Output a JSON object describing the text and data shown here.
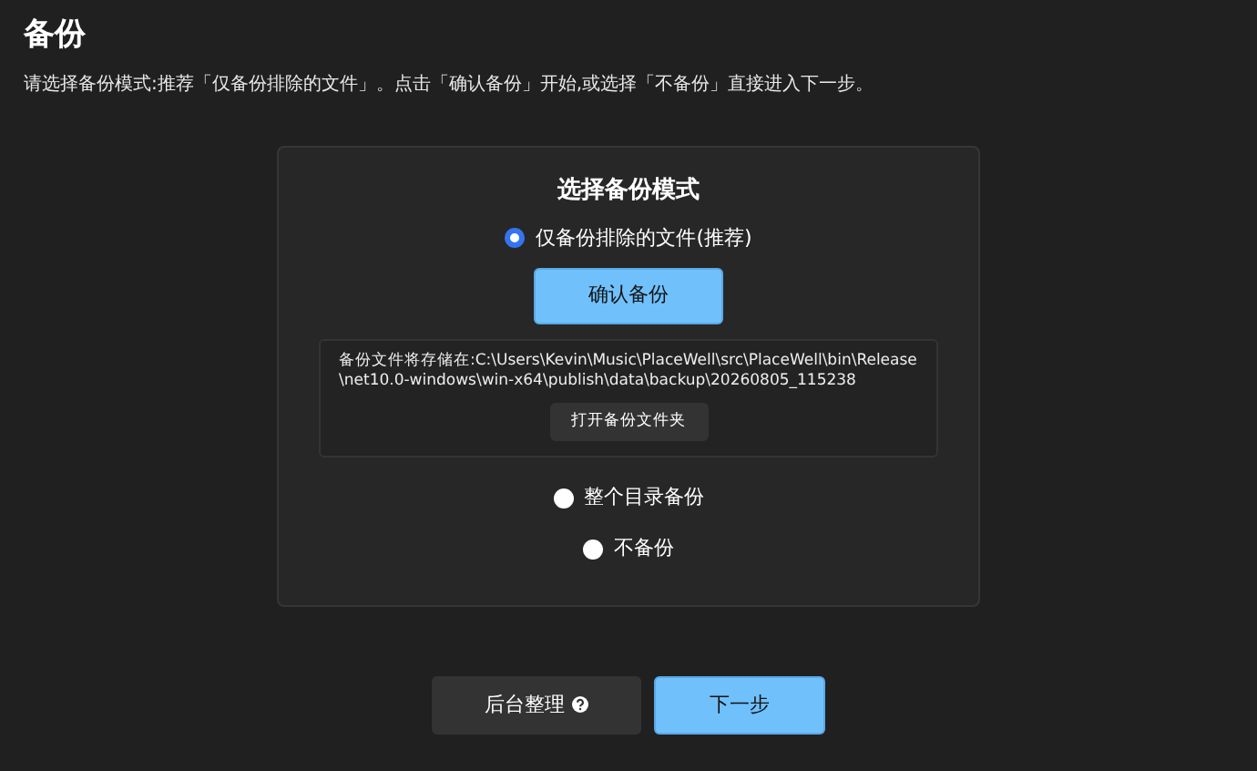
{
  "page": {
    "title": "备份",
    "subtitle": "请选择备份模式:推荐「仅备份排除的文件」。点击「确认备份」开始,或选择「不备份」直接进入下一步。"
  },
  "panel": {
    "title": "选择备份模式",
    "modes": [
      {
        "label": "仅备份排除的文件(推荐)",
        "selected": true,
        "confirm_button": "确认备份",
        "storage_info": "备份文件将存储在:C:\\Users\\Kevin\\Music\\PlaceWell\\src\\PlaceWell\\bin\\Release\\net10.0-windows\\win-x64\\publish\\data\\backup\\20260805_115238",
        "open_folder_button": "打开备份文件夹"
      },
      {
        "label": "整个目录备份",
        "selected": false
      },
      {
        "label": "不备份",
        "selected": false
      }
    ]
  },
  "footer": {
    "buttons": [
      {
        "label": "后台整理",
        "kind": "secondary",
        "help": true
      },
      {
        "label": "下一步",
        "kind": "primary",
        "help": false
      }
    ]
  }
}
